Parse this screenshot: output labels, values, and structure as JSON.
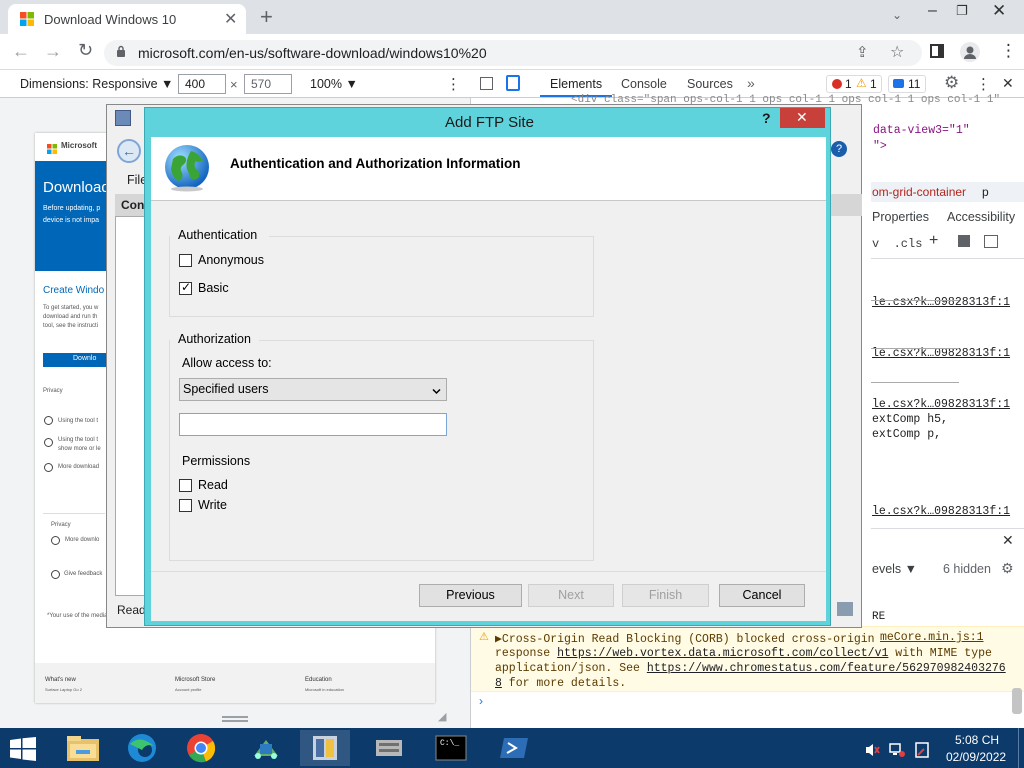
{
  "browser": {
    "tab_title": "Download Windows 10",
    "url": "microsoft.com/en-us/software-download/windows10%20"
  },
  "devtools": {
    "dimensions_label": "Dimensions: Responsive",
    "width": "400",
    "height": "570",
    "times": "×",
    "zoom": "100%",
    "tabs": [
      "Elements",
      "Console",
      "Sources"
    ],
    "error_count": "1",
    "warning_count": "1",
    "message_count": "11",
    "code_top": "data-view3=\"1\"",
    "code_top2": "\">",
    "breadcrumb": "om-grid-container",
    "breadcrumb2": "p",
    "subtabs": [
      "Properties",
      "Accessibility"
    ],
    "styles_toolbar": "v  .cls",
    "css_links": [
      "le.csx?k…09828313f:1",
      "le.csx?k…09828313f:1",
      "le.csx?k…09828313f:1",
      "le.csx?k…09828313f:1"
    ],
    "css_lines": [
      "extComp h5,",
      "extComp p,"
    ],
    "console_levels": "evels ▼",
    "hidden_count": "6 hidden",
    "console_re": "RE",
    "warning_text_1": "▶Cross-Origin Read Blocking (CORB) blocked cross-origin",
    "warning_src": "meCore.min.js:1",
    "warning_text_2": "response",
    "warning_url_1": "https://web.vortex.data.microsoft.com/collect/v1",
    "warning_text_3": " with MIME type",
    "warning_text_4": "application/json. See ",
    "warning_url_2": "https://www.chromestatus.com/feature/562970982403276",
    "warning_url_2b": "8",
    "warning_text_5": " for more details."
  },
  "page_preview": {
    "brand": "Microsoft",
    "hero_title": "Download",
    "hero_line1": "Before updating, p",
    "hero_line2": "device is not impa",
    "create_title": "Create Windo",
    "body_lines": [
      "To get started, you w",
      "download and run th",
      "tool, see the instructi"
    ],
    "download_btn": "Downlo",
    "privacy": "Privacy",
    "accordion": [
      "Using the tool t",
      "Using the tool t",
      "show more or le",
      "More download"
    ],
    "privacy2": "Privacy",
    "more_downloads": "More downlo",
    "give_feedback": "Give feedback",
    "footnote": "*Your use of the media c",
    "footer_cols": [
      "What's new",
      "Microsoft Store",
      "Education"
    ],
    "footer_sub": [
      "Surface Laptop Go 2",
      "Account profile",
      "Microsoft in education"
    ]
  },
  "iis_bg": {
    "menu_file": "File",
    "conn_header": "Conn",
    "status": "Read"
  },
  "dialog": {
    "title": "Add FTP Site",
    "help": "?",
    "heading": "Authentication and Authorization Information",
    "authentication_label": "Authentication",
    "anonymous_label": "Anonymous",
    "anonymous_checked": false,
    "basic_label": "Basic",
    "basic_checked": true,
    "authorization_label": "Authorization",
    "allow_access_label": "Allow access to:",
    "allow_access_value": "Specified users",
    "users_value": "",
    "permissions_label": "Permissions",
    "read_label": "Read",
    "read_checked": false,
    "write_label": "Write",
    "write_checked": false,
    "buttons": {
      "previous": "Previous",
      "next": "Next",
      "finish": "Finish",
      "cancel": "Cancel"
    }
  },
  "taskbar": {
    "time": "5:08 CH",
    "date": "02/09/2022",
    "cmd_text": "C:\\_"
  },
  "colors": {
    "dialog_frame": "#5fd3dc",
    "close_red": "#c8403a",
    "ms_blue": "#0067b8",
    "taskbar": "#0c3a6b"
  }
}
